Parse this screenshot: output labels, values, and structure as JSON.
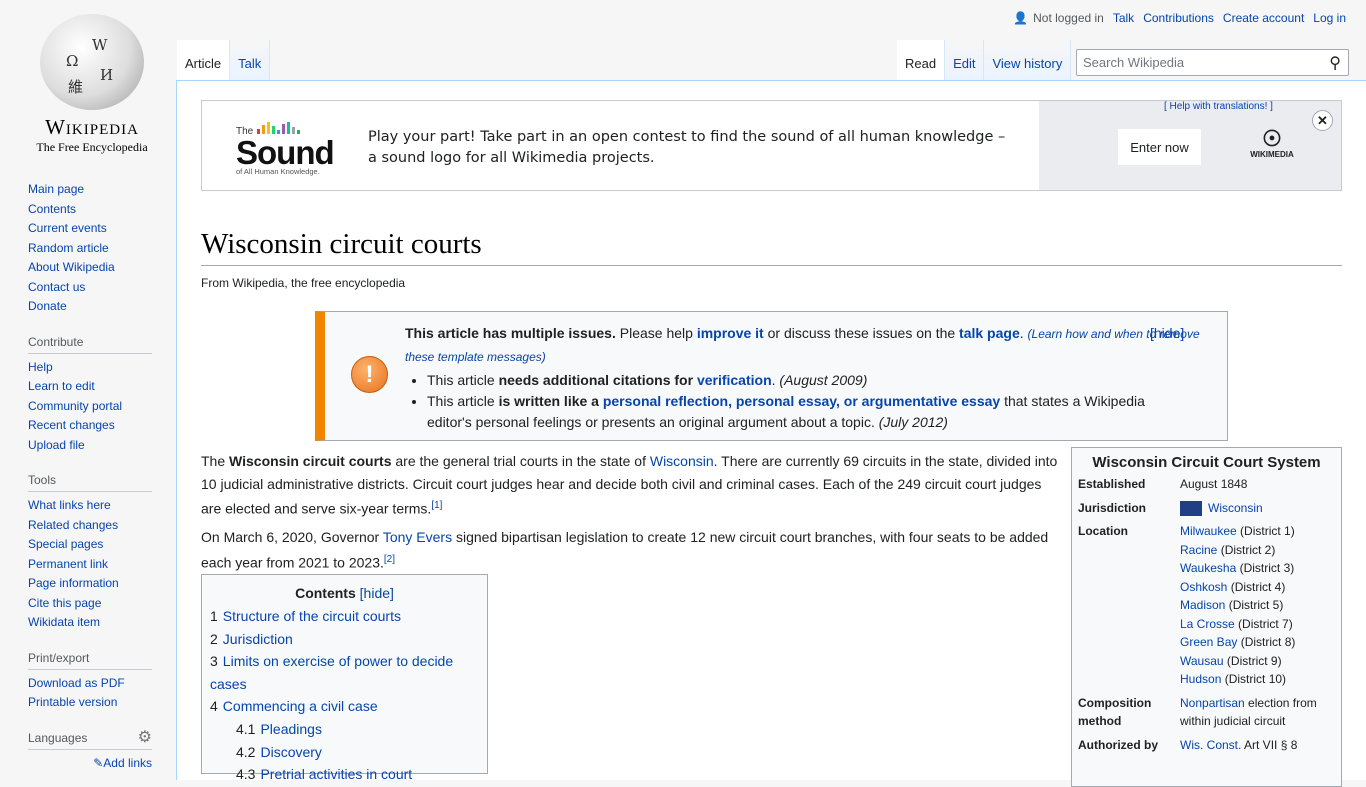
{
  "logo": {
    "wordmark": "Wikipedia",
    "tagline": "The Free Encyclopedia"
  },
  "personal": {
    "status": "Not logged in",
    "links": [
      "Talk",
      "Contributions",
      "Create account",
      "Log in"
    ]
  },
  "tabs_left": [
    "Article",
    "Talk"
  ],
  "tabs_right": [
    "Read",
    "Edit",
    "View history"
  ],
  "search": {
    "placeholder": "Search Wikipedia"
  },
  "banner": {
    "logo_the": "The",
    "logo_sound": "Sound",
    "logo_sub": "of All Human Knowledge.",
    "message": "Play your part! Take part in an open contest to find the sound of all human knowledge – a sound logo for all Wikimedia projects.",
    "help": "[ Help with translations! ]",
    "cta": "Enter now",
    "org": "WIKIMEDIA",
    "bar_colors": [
      "#e03b3b",
      "#f39c12",
      "#f1c40f",
      "#2ecc71",
      "#3498db",
      "#9b59b6",
      "#1abc9c",
      "#95a5a6",
      "#27ae60"
    ]
  },
  "sidebar": {
    "nav": [
      "Main page",
      "Contents",
      "Current events",
      "Random article",
      "About Wikipedia",
      "Contact us",
      "Donate"
    ],
    "contribute": {
      "title": "Contribute",
      "items": [
        "Help",
        "Learn to edit",
        "Community portal",
        "Recent changes",
        "Upload file"
      ]
    },
    "tools": {
      "title": "Tools",
      "items": [
        "What links here",
        "Related changes",
        "Special pages",
        "Permanent link",
        "Page information",
        "Cite this page",
        "Wikidata item"
      ]
    },
    "print": {
      "title": "Print/export",
      "items": [
        "Download as PDF",
        "Printable version"
      ]
    },
    "languages": {
      "title": "Languages",
      "add": "Add links"
    }
  },
  "page": {
    "title": "Wisconsin circuit courts",
    "subtitle": "From Wikipedia, the free encyclopedia"
  },
  "ambox": {
    "lead_bold": "This article has multiple issues.",
    "lead_1": " Please help ",
    "improve": "improve it",
    "lead_2": " or discuss these issues on the ",
    "talk": "talk page",
    "lead_3": ". ",
    "learn": "(Learn how and when to remove these template messages)",
    "hide": "[hide]",
    "issue1": {
      "pre": "This article ",
      "bold": "needs additional citations for ",
      "link": "verification",
      "post": ". ",
      "date": "(August 2009)"
    },
    "issue2": {
      "pre": "This article ",
      "bold": "is written like a ",
      "link": "personal reflection, personal essay, or argumentative essay",
      "post": " that states a Wikipedia editor's personal feelings or presents an original argument about a topic. ",
      "date": "(July 2012)"
    }
  },
  "lead": {
    "p1": {
      "a": "The ",
      "b": "Wisconsin circuit courts",
      "c": " are the general trial courts in the state of ",
      "link": "Wisconsin",
      "d": ". There are currently 69 circuits in the state, divided into 10 judicial administrative districts. Circuit court judges hear and decide both civil and criminal cases. Each of the 249 circuit court judges are elected and serve six-year terms.",
      "ref": "[1]"
    },
    "p2": {
      "a": "On March 6, 2020, Governor ",
      "link": "Tony Evers",
      "b": " signed bipartisan legislation to create 12 new circuit court branches, with four seats to be added each year from 2021 to 2023.",
      "ref": "[2]"
    }
  },
  "toc": {
    "title": "Contents",
    "hide": "[hide]",
    "items": [
      {
        "num": "1",
        "label": "Structure of the circuit courts"
      },
      {
        "num": "2",
        "label": "Jurisdiction"
      },
      {
        "num": "3",
        "label": "Limits on exercise of power to decide cases"
      },
      {
        "num": "4",
        "label": "Commencing a civil case"
      },
      {
        "num": "4.1",
        "label": "Pleadings"
      },
      {
        "num": "4.2",
        "label": "Discovery"
      },
      {
        "num": "4.3",
        "label": "Pretrial activities in court"
      }
    ]
  },
  "infobox": {
    "title": "Wisconsin Circuit Court System",
    "established": {
      "label": "Established",
      "value": "August 1848"
    },
    "jurisdiction": {
      "label": "Jurisdiction",
      "value": "Wisconsin"
    },
    "location": {
      "label": "Location",
      "items": [
        {
          "city": "Milwaukee",
          "district": " (District 1)"
        },
        {
          "city": "Racine",
          "district": " (District 2)"
        },
        {
          "city": "Waukesha",
          "district": " (District 3)"
        },
        {
          "city": "Oshkosh",
          "district": " (District 4)"
        },
        {
          "city": "Madison",
          "district": " (District 5)"
        },
        {
          "city": "La Crosse",
          "district": " (District 7)"
        },
        {
          "city": "Green Bay",
          "district": " (District 8)"
        },
        {
          "city": "Wausau",
          "district": " (District 9)"
        },
        {
          "city": "Hudson",
          "district": " (District 10)"
        }
      ]
    },
    "composition": {
      "label": "Composition method",
      "link": "Nonpartisan",
      "value": " election from within judicial circuit"
    },
    "authorized": {
      "label": "Authorized by",
      "link": "Wis. Const.",
      "value": " Art VII § 8"
    }
  }
}
